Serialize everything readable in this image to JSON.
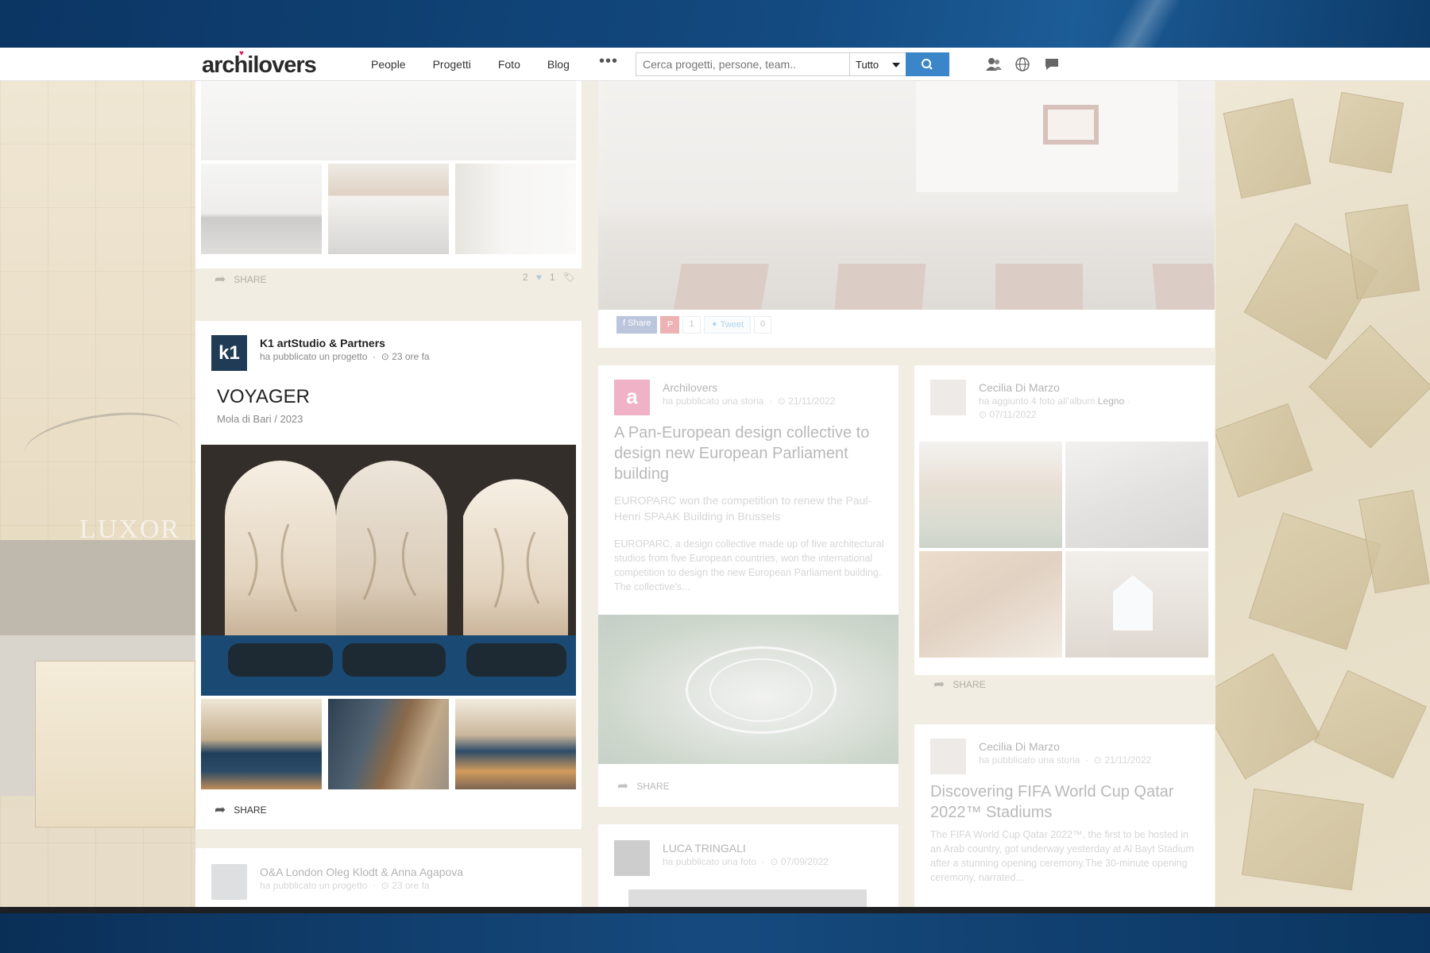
{
  "header": {
    "logo": "archilovers",
    "nav": [
      "People",
      "Progetti",
      "Foto",
      "Blog"
    ],
    "more": "•••",
    "search_placeholder": "Cerca progetti, persone, team..",
    "search_scope": "Tutto"
  },
  "background": {
    "sign_text": "LUXOR"
  },
  "card_top": {
    "share": "SHARE",
    "likes": "2",
    "tags": "1"
  },
  "card_project": {
    "author": "K1 artStudio & Partners",
    "action": "ha pubblicato un progetto",
    "time": "23 ore fa",
    "title": "VOYAGER",
    "subtitle": "Mola di Bari / 2023",
    "share": "SHARE"
  },
  "card_project_next": {
    "author": "O&A London Oleg Klodt & Anna Agapova",
    "action": "ha pubblicato un progetto",
    "time": "23 ore fa"
  },
  "card_featured": {
    "share": "Share",
    "pin_count": "1",
    "tweet": "Tweet",
    "tweet_count": "0"
  },
  "card_story1": {
    "author": "Archilovers",
    "action": "ha pubblicato una storia",
    "date": "21/11/2022",
    "title": "A Pan-European design collective to design new European Parliament building",
    "subtitle": "EUROPARC won the competition to renew the Paul-Henri SPAAK Building in Brussels",
    "body": "EUROPARC, a design collective made up of five architectural studios from five European countries, won the international competition to design the new European Parliament building. The collective's...",
    "share": "SHARE"
  },
  "card_album": {
    "author": "Cecilia Di Marzo",
    "action": "ha aggiunto 4 foto all'album",
    "album": "Legno",
    "date": "07/11/2022",
    "share": "SHARE"
  },
  "card_story2": {
    "author": "Cecilia Di Marzo",
    "action": "ha pubblicato una storia",
    "date": "21/11/2022",
    "title": "Discovering FIFA World Cup Qatar 2022™ Stadiums",
    "body": "The FIFA World Cup Qatar 2022™, the first to be hosted in an Arab country, got underway yesterday at Al Bayt Stadium after a stunning opening ceremony.The 30-minute opening ceremony, narrated..."
  },
  "card_photo": {
    "author": "LUCA TRINGALI",
    "action": "ha pubblicato una foto",
    "date": "07/09/2022"
  },
  "colors": {
    "accent": "#3b86c9",
    "brand_heart": "#d61f5c",
    "facebook": "#3b5998",
    "pinterest": "#cb2027"
  }
}
